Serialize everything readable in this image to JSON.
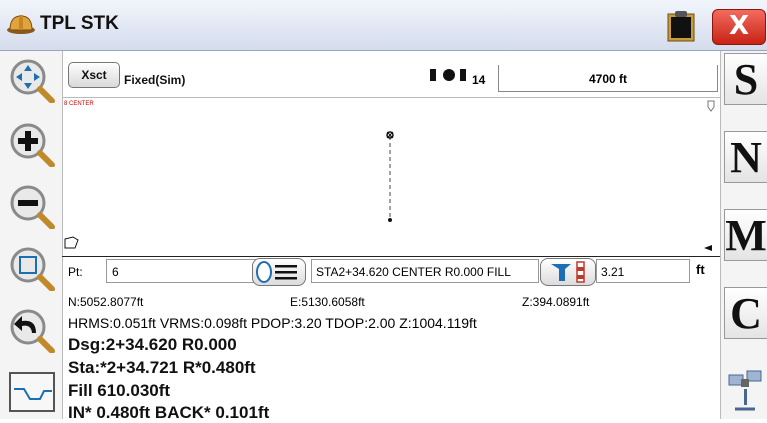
{
  "app": {
    "title": "TPL STK",
    "close_label": "X"
  },
  "status": {
    "mode_button": "Xsct",
    "fix_status": "Fixed(Sim)",
    "sat_count": "14",
    "scale": "4700 ft"
  },
  "canvas": {
    "center_tag": "8 CENTER"
  },
  "point_row": {
    "pt_label": "Pt:",
    "pt_value": "6",
    "station_value": "STA2+34.620 CENTER R0.000 FILL",
    "rod_value": "3.21",
    "unit": "ft"
  },
  "readout": {
    "northing": "N:5052.8077ft",
    "easting": "E:5130.6058ft",
    "elevation": "Z:394.0891ft",
    "quality": "HRMS:0.051ft VRMS:0.098ft PDOP:3.20 TDOP:2.00 Z:1004.119ft",
    "design": "Dsg:2+34.620 R0.000",
    "station": "Sta:*2+34.721 R*0.480ft",
    "cutfill": "Fill 610.030ft",
    "direction": "IN* 0.480ft BACK* 0.101ft"
  },
  "right_buttons": [
    "S",
    "N",
    "M",
    "C"
  ],
  "icons": [
    "helmet-icon",
    "clipboard-icon",
    "pan-icon",
    "zoom-in-icon",
    "zoom-out-icon",
    "zoom-window-icon",
    "undo-zoom-icon",
    "profile-icon",
    "list-icon",
    "rod-height-icon",
    "satellite-icon"
  ]
}
